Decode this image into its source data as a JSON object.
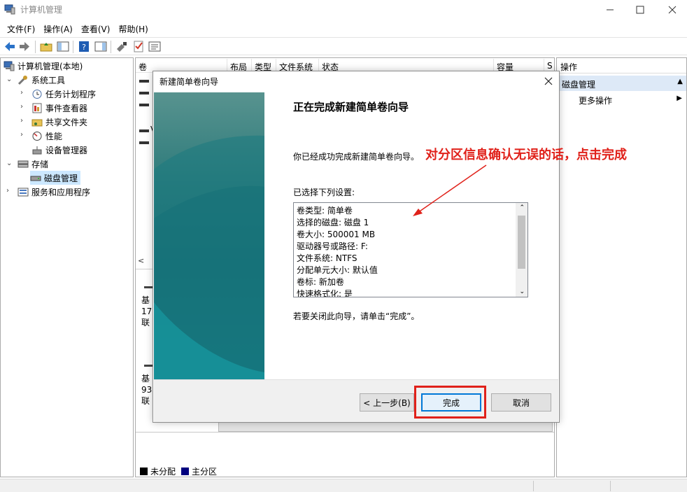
{
  "window": {
    "title": "计算机管理"
  },
  "menu": [
    "文件(F)",
    "操作(A)",
    "查看(V)",
    "帮助(H)"
  ],
  "tree": {
    "root": "计算机管理(本地)",
    "system_tools": "系统工具",
    "task_scheduler": "任务计划程序",
    "event_viewer": "事件查看器",
    "shared_folders": "共享文件夹",
    "performance": "性能",
    "device_manager": "设备管理器",
    "storage": "存储",
    "disk_management": "磁盘管理",
    "services_apps": "服务和应用程序"
  },
  "volume_columns": [
    "卷",
    "布局",
    "类型",
    "文件系统",
    "状态",
    "容量",
    "S"
  ],
  "volume_rows_partial": [
    "",
    "",
    "",
    "V",
    ""
  ],
  "disk_blocks": [
    {
      "line1": "基",
      "line2": "17",
      "line3": "联"
    },
    {
      "line1": "基",
      "line2": "93",
      "line3": "联"
    }
  ],
  "legend": [
    {
      "label": "未分配",
      "color": "#000000"
    },
    {
      "label": "主分区",
      "color": "#00007f"
    }
  ],
  "actions": {
    "header": "操作",
    "section": "磁盘管理",
    "more": "更多操作"
  },
  "dialog": {
    "title": "新建简单卷向导",
    "heading": "正在完成新建简单卷向导",
    "text_done": "你已经成功完成新建简单卷向导。",
    "text_selected": "已选择下列设置:",
    "summary": [
      "卷类型: 简单卷",
      "选择的磁盘: 磁盘 1",
      "卷大小: 500001 MB",
      "驱动器号或路径: F:",
      "文件系统: NTFS",
      "分配单元大小: 默认值",
      "卷标: 新加卷",
      "快速格式化: 是"
    ],
    "text_close": "若要关闭此向导，请单击“完成”。",
    "btn_back": "< 上一步(B)",
    "btn_finish": "完成",
    "btn_cancel": "取消"
  },
  "annotation": {
    "text": "对分区信息确认无误的话，点击完成",
    "color": "#e0211a"
  }
}
